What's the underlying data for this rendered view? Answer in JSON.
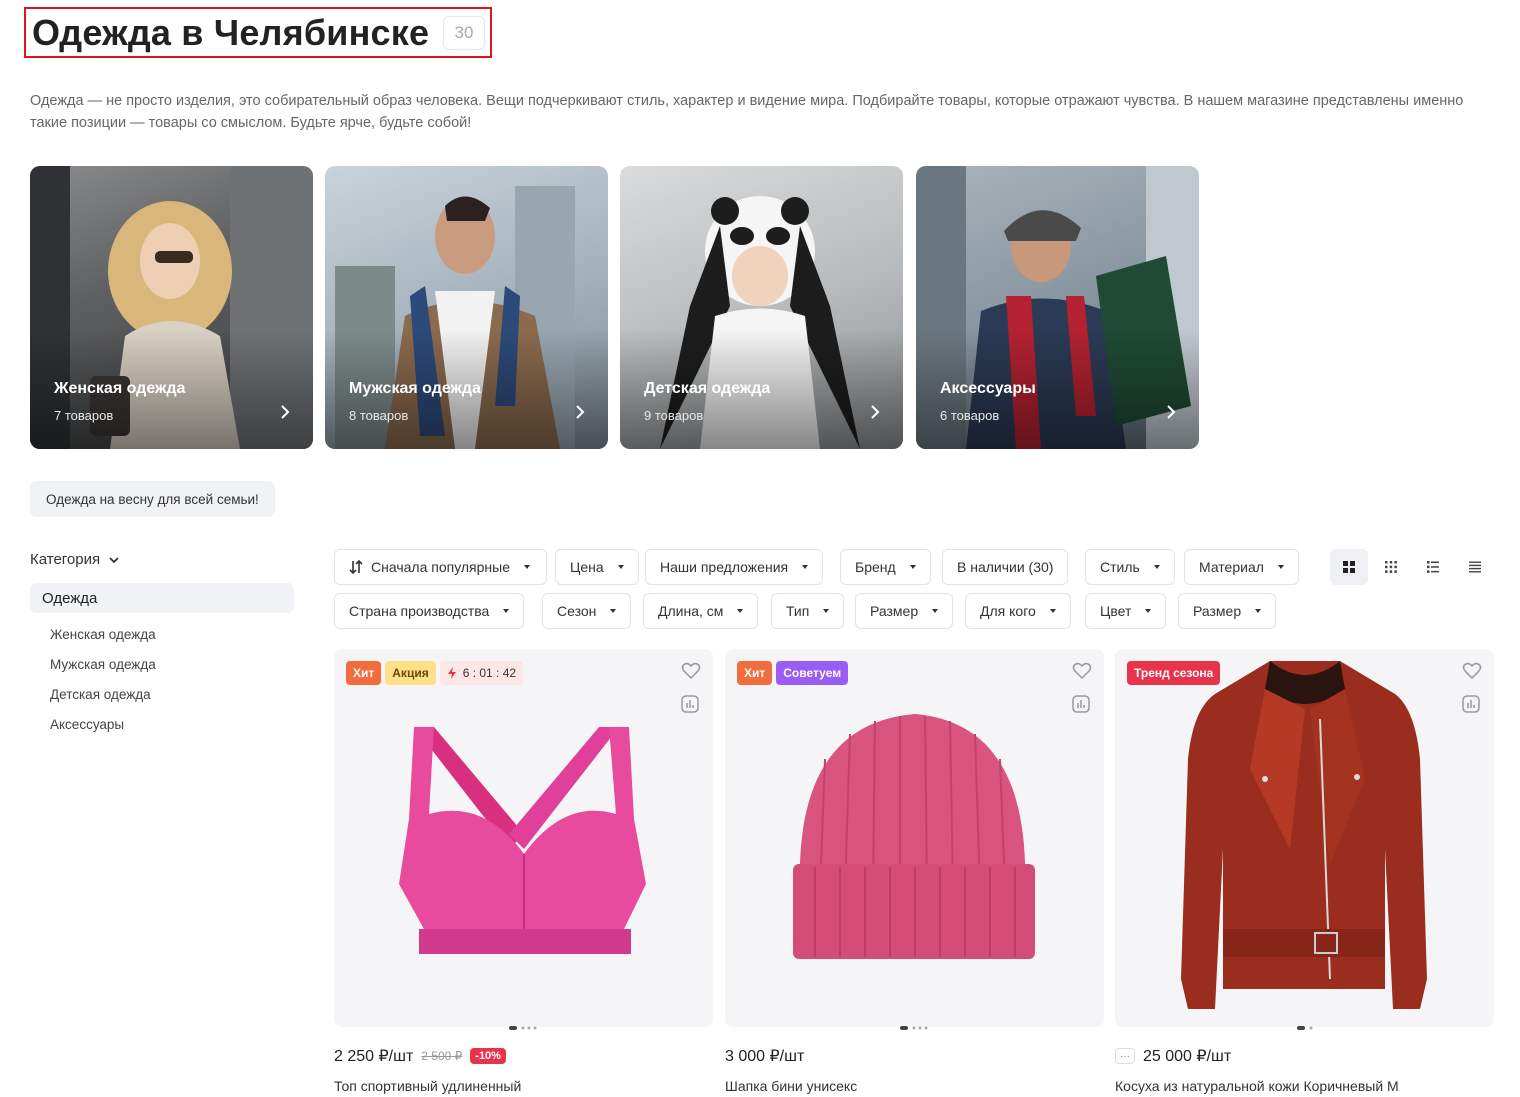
{
  "header": {
    "title": "Одежда в Челябинске",
    "count": "30"
  },
  "description": "Одежда — не просто изделия, это собирательный образ человека. Вещи подчеркивают стиль, характер и видение мира. Подбирайте товары, которые отражают чувства. В нашем магазине представлены именно такие позиции — товары со смыслом. Будьте ярче, будьте собой!",
  "categories": [
    {
      "name": "Женская одежда",
      "count": "7 товаров"
    },
    {
      "name": "Мужская одежда",
      "count": "8 товаров"
    },
    {
      "name": "Детская одежда",
      "count": "9 товаров"
    },
    {
      "name": "Аксессуары",
      "count": "6 товаров"
    }
  ],
  "promo_tag": "Одежда на весну для всей семьи!",
  "sidebar": {
    "heading": "Категория",
    "active": "Одежда",
    "items": [
      "Женская одежда",
      "Мужская одежда",
      "Детская одежда",
      "Аксессуары"
    ]
  },
  "filters": {
    "sort": "Сначала популярные",
    "row1": [
      "Цена",
      "Наши предложения",
      "Бренд",
      "В наличии (30)",
      "Стиль",
      "Материал"
    ],
    "row2": [
      "Страна производства",
      "Сезон",
      "Длина, см",
      "Тип",
      "Размер",
      "Для кого",
      "Цвет",
      "Размер"
    ]
  },
  "view_modes": [
    "grid-large-icon",
    "grid-small-icon",
    "list-icon",
    "table-icon"
  ],
  "products": [
    {
      "badges": [
        "Хит",
        "Акция"
      ],
      "timer": "6 : 01 : 42",
      "price": "2 250 ₽/шт",
      "old_price": "2 500 ₽",
      "discount": "-10%",
      "name": "Топ спортивный удлиненный"
    },
    {
      "badges": [
        "Хит",
        "Советуем"
      ],
      "price": "3 000 ₽/шт",
      "name": "Шапка бини унисекс"
    },
    {
      "badges": [
        "Тренд сезона"
      ],
      "more": "···",
      "price": "25 000 ₽/шт",
      "name": "Косуха из натуральной кожи Коричневый M"
    }
  ],
  "colors": {
    "hit": "#f26d3d",
    "sale": "#ffe08a",
    "timer": "#fde6e6",
    "recommend": "#9b5cf6",
    "trend": "#e8334a",
    "highlight": "#e0141e"
  }
}
